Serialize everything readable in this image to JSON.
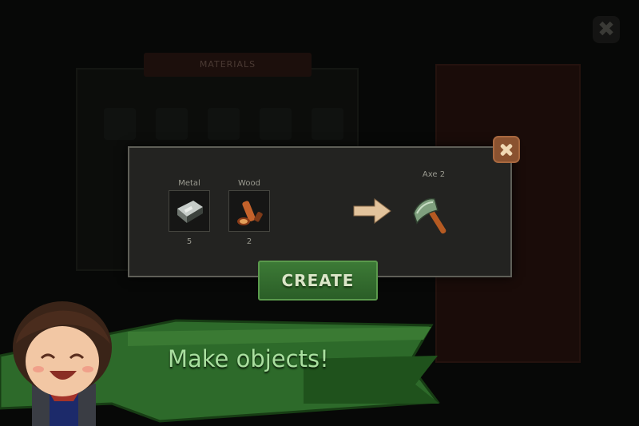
{
  "background": {
    "materials_header": "MATERIALS",
    "close_icon": "close-icon"
  },
  "dialog": {
    "materials": [
      {
        "label": "Metal",
        "quantity": "5",
        "icon": "metal-ingot-icon"
      },
      {
        "label": "Wood",
        "quantity": "2",
        "icon": "wood-log-icon"
      }
    ],
    "arrow_icon": "right-arrow-icon",
    "result": {
      "label": "Axe 2",
      "icon": "axe-icon"
    },
    "close_icon": "close-icon",
    "create_label": "CREATE"
  },
  "tutorial": {
    "message": "Make objects!"
  },
  "colors": {
    "dialog_bg": "#232321",
    "create_green": "#3c7a36",
    "banner_green": "#2d6a2a",
    "banner_text": "#a9df9f",
    "close_orange": "#8a5230"
  }
}
